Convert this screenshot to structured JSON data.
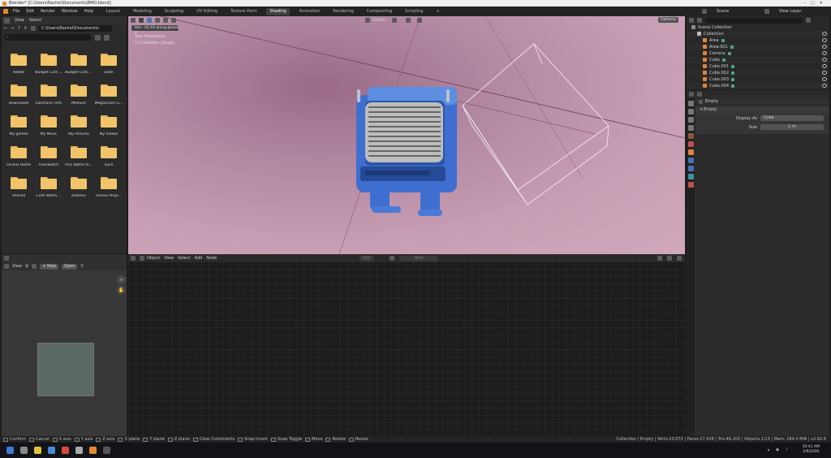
{
  "window_title": "Blender* [C:\\Users\\Rachel\\Documents\\BMO.blend]",
  "menu": [
    "File",
    "Edit",
    "Render",
    "Window",
    "Help"
  ],
  "workspace_tabs": [
    "Layout",
    "Modeling",
    "Sculpting",
    "UV Editing",
    "Texture Paint",
    "Shading",
    "Animation",
    "Rendering",
    "Compositing",
    "Scripting"
  ],
  "active_tab": "Shading",
  "scene_label": "Scene",
  "view_layer_label": "View Layer",
  "file_browser": {
    "menu": [
      "View",
      "Select"
    ],
    "path": "C:\\Users\\Rachel\\Documents\\",
    "folders": [
      "Adobe",
      "Budget Cuts ...",
      "Budget Cuts ...",
      "Dash",
      "Downloads",
      "Electronic Arts",
      "Medium",
      "Megascans Li...",
      "My games",
      "My Music",
      "My Pictures",
      "My Videos",
      "Oculus Home",
      "Overwatch",
      "PVZ Battle fo...",
      "Quill",
      "Shared",
      "STAR WARS ...",
      "steamvr",
      "Unreal Proje..."
    ]
  },
  "image_editor": {
    "view": "View",
    "new": "New",
    "open": "Open"
  },
  "viewport": {
    "info_bar": "Rot: -42.43 along global Y",
    "perspective": "User Perspective",
    "collection": "(1) Collection | Empty",
    "orientation": "Global",
    "options": "Options"
  },
  "node_editor": {
    "mode": "Object",
    "menu": [
      "View",
      "Select",
      "Add",
      "Node"
    ],
    "slot": "Slot",
    "new": "New"
  },
  "outliner": {
    "rows": [
      {
        "label": "Scene Collection",
        "indent": 0,
        "color": "#8c8c8c"
      },
      {
        "label": "Collection",
        "indent": 1,
        "color": "#bcbcbc"
      },
      {
        "label": "Area",
        "indent": 2,
        "color": "#e0843a"
      },
      {
        "label": "Area.001",
        "indent": 2,
        "color": "#e0843a"
      },
      {
        "label": "Camera",
        "indent": 2,
        "color": "#e0843a"
      },
      {
        "label": "Cube",
        "indent": 2,
        "color": "#e0843a"
      },
      {
        "label": "Cube.001",
        "indent": 2,
        "color": "#e0843a"
      },
      {
        "label": "Cube.002",
        "indent": 2,
        "color": "#e0843a"
      },
      {
        "label": "Cube.003",
        "indent": 2,
        "color": "#e0843a"
      },
      {
        "label": "Cube.004",
        "indent": 2,
        "color": "#e0843a"
      }
    ]
  },
  "properties": {
    "object_name": "Empty",
    "panel_title": "Empty",
    "display_as_label": "Display As",
    "display_as_value": "Cube",
    "size_label": "Size",
    "size_value": "1 m"
  },
  "status_bar": {
    "items": [
      "Confirm",
      "Cancel",
      "X axis",
      "Y axis",
      "Z axis",
      "X plane",
      "Y plane",
      "Z plane",
      "Clear Constraints",
      "Snap Invert",
      "Snap Toggle",
      "Move",
      "Rotate",
      "Resize"
    ],
    "stats": "Collection | Empty | Verts:23,072 | Faces:17,438 | Tris:46,200 | Objects:1/13 | Mem: 184.0 MiB | v2.82.6"
  },
  "taskbar": {
    "time": "10:41 AM",
    "date": "2/9/2020"
  },
  "colors": {
    "accent": "#4772b3",
    "folder": "#f1c46a",
    "viewport_bg": "#b48aa3"
  }
}
